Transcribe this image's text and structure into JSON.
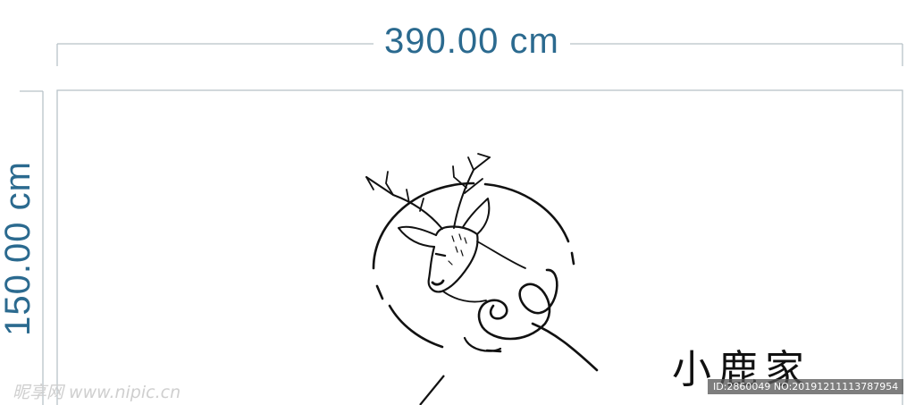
{
  "dimensions": {
    "width_label": "390.00 cm",
    "height_label": "150.00 cm"
  },
  "sign": {
    "brand_text": "小鹿家"
  },
  "watermarks": {
    "left_text": "昵享网 www.nipic.cn",
    "right_text": "ID:2860049 NO:20191211113787954"
  },
  "colors": {
    "dimension_color": "#2b6a8f",
    "line_color": "#111111",
    "panel_border": "#b8c2c8"
  }
}
